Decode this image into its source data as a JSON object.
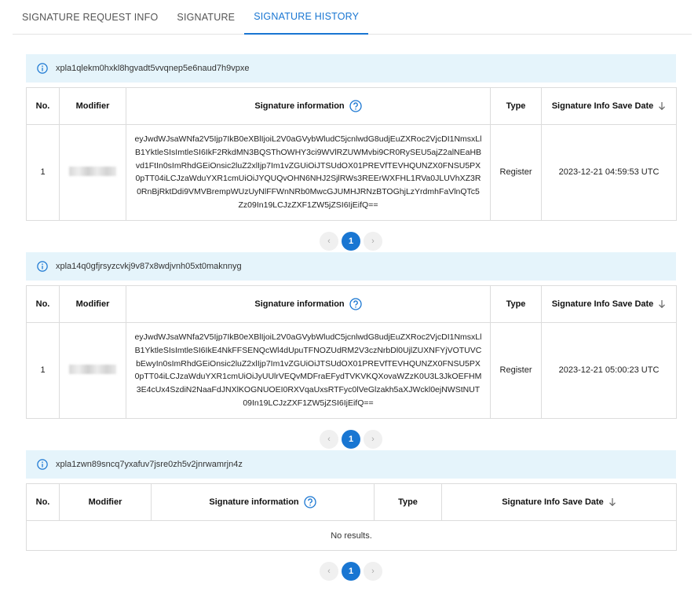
{
  "tabs": [
    "SIGNATURE REQUEST INFO",
    "SIGNATURE",
    "SIGNATURE HISTORY"
  ],
  "active_tab": 2,
  "columns": {
    "no": "No.",
    "modifier": "Modifier",
    "signature_info": "Signature information",
    "type": "Type",
    "save_date": "Signature Info Save Date"
  },
  "sections": [
    {
      "address": "xpla1qlekm0hxkl8hgvadt5vvqnep5e6naud7h9vpxe",
      "rows": [
        {
          "no": "1",
          "signature": "eyJwdWJsaWNfa2V5Ijp7IkB0eXBlIjoiL2V0aGVybWludC5jcnlwdG8udjEuZXRoc2VjcDI1NmsxLlB1YktleSIsImtleSI6IkF2RkdMN3BQSThOWHY3ci9WVlRZUWMvbi9CR0RySEU5ajZ2alNEaHBvd1FtIn0sImRhdGEiOnsic2luZ2xlIjp7Im1vZGUiOiJTSUdOX01PREVfTEVHQUNZX0FNSU5PX0pTT04iLCJzaWduYXR1cmUiOiJYQUQvOHN6NHJ2SjlRWs3REErWXFHL1RVa0JLUVhXZ3R0RnBjRktDdi9VMVBrempWUzUyNlFFWnNRb0MwcGJUMHJRNzBTOGhjLzYrdmhFaVlnQTc5Zz09In19LCJzZXF1ZW5jZSI6IjEifQ==",
          "type": "Register",
          "date": "2023-12-21 04:59:53 UTC"
        }
      ],
      "page": "1"
    },
    {
      "address": "xpla14q0gfjrsyzcvkj9v87x8wdjvnh05xt0maknnyg",
      "rows": [
        {
          "no": "1",
          "signature": "eyJwdWJsaWNfa2V5Ijp7IkB0eXBlIjoiL2V0aGVybWludC5jcnlwdG8udjEuZXRoc2VjcDI1NmsxLlB1YktleSIsImtleSI6IkE4NkFFSENQcWl4dUpuTFNOZUdRM2V3czNrbDl0UjlZUXNFYjVOTUVCbEwyIn0sImRhdGEiOnsic2luZ2xlIjp7Im1vZGUiOiJTSUdOX01PREVfTEVHQUNZX0FNSU5PX0pTT04iLCJzaWduYXR1cmUiOiJyUUlrVEQvMDFraEFydTVKVKQXovaWZzK0U3L3JkOEFHM3E4cUx4SzdiN2NaaFdJNXlKOGNUOEI0RXVqaUxsRTFyc0lVeGlzakh5aXJWckl0ejNWStNUT09In19LCJzZXF1ZW5jZSI6IjEifQ==",
          "type": "Register",
          "date": "2023-12-21 05:00:23 UTC"
        }
      ],
      "page": "1"
    },
    {
      "address": "xpla1zwn89sncq7yxafuv7jsre0zh5v2jnrwamrjn4z",
      "rows": [],
      "empty_text": "No results.",
      "page": "1"
    }
  ],
  "pager": {
    "prev": "‹",
    "next": "›"
  },
  "colors": {
    "accent": "#1976d2",
    "banner": "#e5f4fb"
  }
}
